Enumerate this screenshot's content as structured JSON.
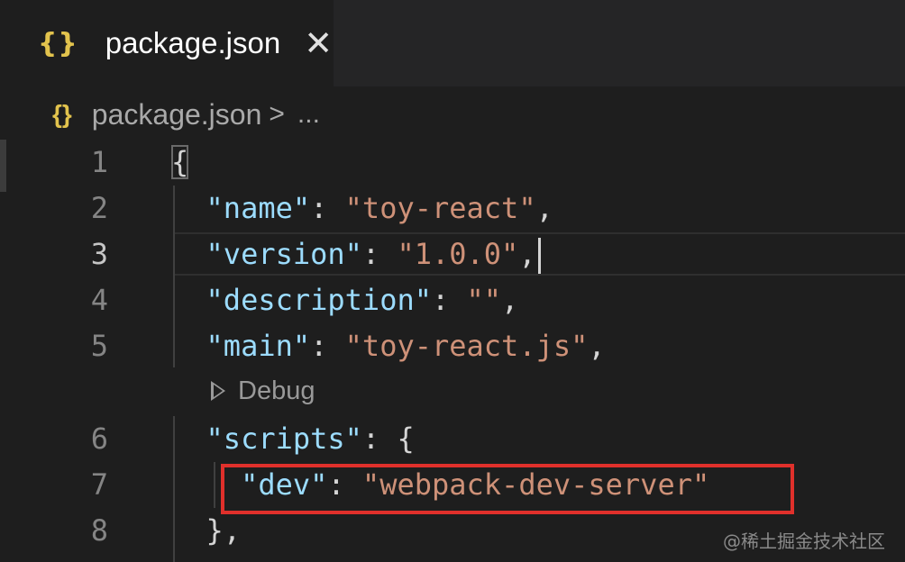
{
  "tab": {
    "icon": "{}",
    "label": "package.json",
    "close": "✕"
  },
  "breadcrumb": {
    "icon": "{}",
    "file": "package.json",
    "separator": ">",
    "more": "..."
  },
  "lines": [
    {
      "num": "1",
      "tokens": [
        {
          "t": "p",
          "v": "{"
        }
      ]
    },
    {
      "num": "2",
      "tokens": [
        {
          "t": "k",
          "v": "  \"name\""
        },
        {
          "t": "p",
          "v": ": "
        },
        {
          "t": "s",
          "v": "\"toy-react\""
        },
        {
          "t": "p",
          "v": ","
        }
      ]
    },
    {
      "num": "3",
      "tokens": [
        {
          "t": "k",
          "v": "  \"version\""
        },
        {
          "t": "p",
          "v": ": "
        },
        {
          "t": "s",
          "v": "\"1.0.0\""
        },
        {
          "t": "p",
          "v": ","
        }
      ]
    },
    {
      "num": "4",
      "tokens": [
        {
          "t": "k",
          "v": "  \"description\""
        },
        {
          "t": "p",
          "v": ": "
        },
        {
          "t": "s",
          "v": "\"\""
        },
        {
          "t": "p",
          "v": ","
        }
      ]
    },
    {
      "num": "5",
      "tokens": [
        {
          "t": "k",
          "v": "  \"main\""
        },
        {
          "t": "p",
          "v": ": "
        },
        {
          "t": "s",
          "v": "\"toy-react.js\""
        },
        {
          "t": "p",
          "v": ","
        }
      ]
    },
    {
      "num": "6",
      "tokens": [
        {
          "t": "k",
          "v": "  \"scripts\""
        },
        {
          "t": "p",
          "v": ": {"
        }
      ]
    },
    {
      "num": "7",
      "tokens": [
        {
          "t": "k",
          "v": "    \"dev\""
        },
        {
          "t": "p",
          "v": ": "
        },
        {
          "t": "s",
          "v": "\"webpack-dev-server\""
        }
      ]
    },
    {
      "num": "8",
      "tokens": [
        {
          "t": "p",
          "v": "  },"
        }
      ]
    }
  ],
  "current_line": "3",
  "codelens": {
    "label": "Debug"
  },
  "watermark": "@稀土掘金技术社区",
  "colors": {
    "key": "#9cdcfe",
    "string": "#ce9178",
    "highlight_box": "#e0302b",
    "json_icon": "#e2c34d"
  }
}
